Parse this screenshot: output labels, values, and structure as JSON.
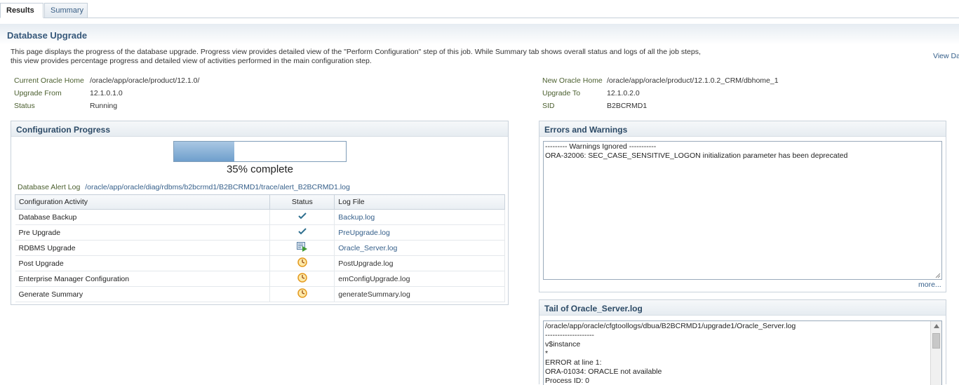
{
  "tabs": [
    {
      "label": "Results"
    },
    {
      "label": "Summary"
    }
  ],
  "page": {
    "title": "Database Upgrade",
    "description_line1": "This page displays the progress of the database upgrade. Progress view provides detailed view of the \"Perform Configuration\" step of this job. While Summary tab shows overall status and logs of all the job steps,",
    "description_line2": "this view provides percentage progress and detailed view of activities performed in the main configuration step.",
    "view_link": "View Da"
  },
  "info_left": {
    "current_home_label": "Current Oracle Home",
    "current_home_value": "/oracle/app/oracle/product/12.1.0/",
    "upgrade_from_label": "Upgrade From",
    "upgrade_from_value": "12.1.0.1.0",
    "status_label": "Status",
    "status_value": "Running"
  },
  "info_right": {
    "new_home_label": "New Oracle Home",
    "new_home_value": "/oracle/app/oracle/product/12.1.0.2_CRM/dbhome_1",
    "upgrade_to_label": "Upgrade To",
    "upgrade_to_value": "12.1.0.2.0",
    "sid_label": "SID",
    "sid_value": "B2BCRMD1"
  },
  "config_progress": {
    "title": "Configuration Progress",
    "percent": 35,
    "percent_text": "35% complete",
    "alert_log_label": "Database Alert Log",
    "alert_log_path": "/oracle/app/oracle/diag/rdbms/b2bcrmd1/B2BCRMD1/trace/alert_B2BCRMD1.log",
    "columns": [
      "Configuration Activity",
      "Status",
      "Log File"
    ],
    "rows": [
      {
        "activity": "Database Backup",
        "status_icon": "checkmark-icon",
        "log": "Backup.log",
        "log_link": true
      },
      {
        "activity": "Pre Upgrade",
        "status_icon": "checkmark-icon",
        "log": "PreUpgrade.log",
        "log_link": true
      },
      {
        "activity": "RDBMS Upgrade",
        "status_icon": "in-progress-icon",
        "log": "Oracle_Server.log",
        "log_link": true
      },
      {
        "activity": "Post Upgrade",
        "status_icon": "clock-icon",
        "log": "PostUpgrade.log",
        "log_link": false
      },
      {
        "activity": "Enterprise Manager Configuration",
        "status_icon": "clock-icon",
        "log": "emConfigUpgrade.log",
        "log_link": false
      },
      {
        "activity": "Generate Summary",
        "status_icon": "clock-icon",
        "log": "generateSummary.log",
        "log_link": false
      }
    ]
  },
  "errors_warnings": {
    "title": "Errors and Warnings",
    "line1": "--------- Warnings Ignored -----------",
    "line2": "ORA-32006: SEC_CASE_SENSITIVE_LOGON initialization parameter has been deprecated",
    "more_link": "more..."
  },
  "tail_log": {
    "title": "Tail of Oracle_Server.log",
    "lines": [
      "/oracle/app/oracle/cfgtoollogs/dbua/B2BCRMD1/upgrade1/Oracle_Server.log",
      "--------------------",
      "v$instance",
      "*",
      "ERROR at line 1:",
      "ORA-01034: ORACLE not available",
      "Process ID: 0"
    ]
  },
  "colors": {
    "accent": "#36587a",
    "link": "#355f8a",
    "label_olive": "#4b5f2f",
    "progress_fill": "#6f9fcc",
    "check_green": "#2f6f8f",
    "clock_orange": "#e49a1f"
  }
}
